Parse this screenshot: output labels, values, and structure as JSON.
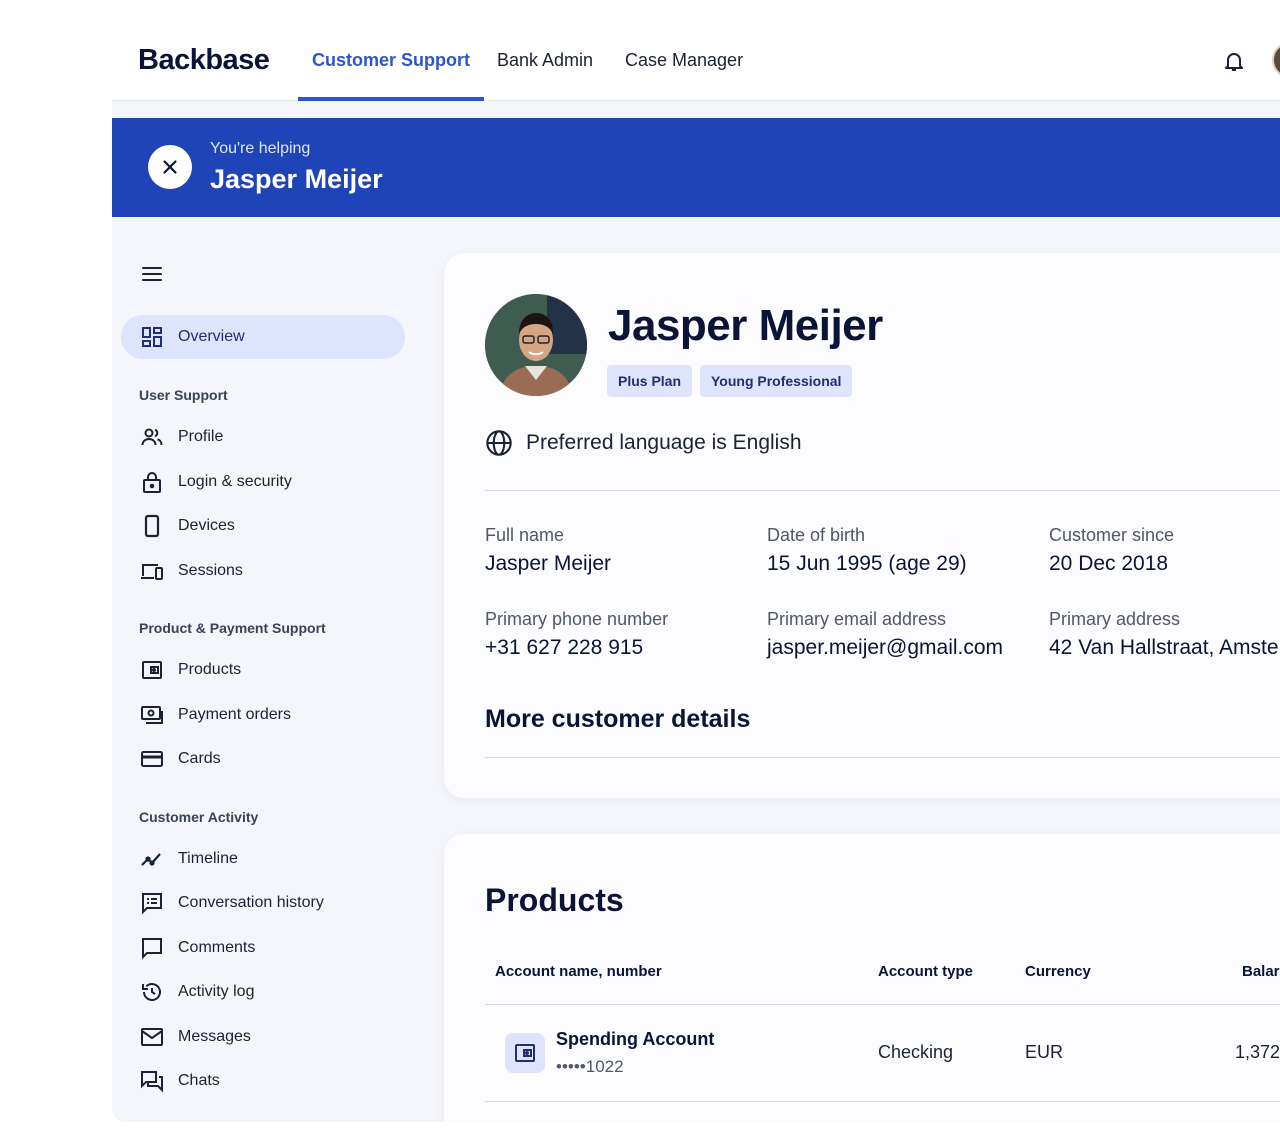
{
  "header": {
    "logo": "Backbase",
    "tabs": [
      {
        "label": "Customer Support",
        "active": true
      },
      {
        "label": "Bank Admin",
        "active": false
      },
      {
        "label": "Case Manager",
        "active": false
      }
    ],
    "icons": {
      "notifications": "bell-icon",
      "user": "avatar"
    }
  },
  "banner": {
    "label": "You're helping",
    "name": "Jasper Meijer"
  },
  "sidebar": {
    "overview": "Overview",
    "sections": [
      {
        "title": "User Support",
        "items": [
          "Profile",
          "Login & security",
          "Devices",
          "Sessions"
        ]
      },
      {
        "title": "Product & Payment Support",
        "items": [
          "Products",
          "Payment orders",
          "Cards"
        ]
      },
      {
        "title": "Customer Activity",
        "items": [
          "Timeline",
          "Conversation history",
          "Comments",
          "Activity log",
          "Messages",
          "Chats"
        ]
      }
    ]
  },
  "customer": {
    "name": "Jasper Meijer",
    "tags": [
      "Plus Plan",
      "Young Professional"
    ],
    "language": "Preferred language is English",
    "fields": [
      {
        "label": "Full name",
        "value": "Jasper Meijer"
      },
      {
        "label": "Date of birth",
        "value": "15 Jun 1995 (age 29)"
      },
      {
        "label": "Customer since",
        "value": "20 Dec 2018"
      },
      {
        "label": "Primary phone number",
        "value": "+31 627 228 915"
      },
      {
        "label": "Primary email address",
        "value": "jasper.meijer@gmail.com"
      },
      {
        "label": "Primary address",
        "value": "42 Van Hallstraat, Amste"
      }
    ],
    "more_details": "More customer details"
  },
  "products": {
    "title": "Products",
    "columns": [
      "Account name, number",
      "Account type",
      "Currency",
      "Balar"
    ],
    "rows": [
      {
        "name": "Spending Account",
        "number": "•••••1022",
        "type": "Checking",
        "currency": "EUR",
        "balance": "1,372"
      }
    ]
  },
  "colors": {
    "accent": "#2f54cf",
    "banner": "#1f44b8",
    "tag_bg": "#dde4fb"
  }
}
